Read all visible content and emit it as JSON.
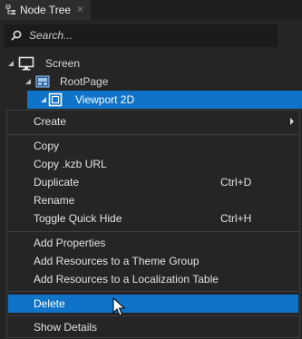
{
  "panel": {
    "tab_title": "Node Tree",
    "close_glyph": "×",
    "tab_icon": "node-tree-icon"
  },
  "search": {
    "placeholder": "Search...",
    "value": ""
  },
  "tree": {
    "items": [
      {
        "label": "Screen",
        "icon": "monitor-icon",
        "expanded": true
      },
      {
        "label": "RootPage",
        "icon": "page-icon",
        "expanded": true
      },
      {
        "label": "Viewport 2D",
        "icon": "viewport-icon",
        "expanded": true,
        "selected": true
      }
    ]
  },
  "context_menu": {
    "items": [
      {
        "label": "Create",
        "shortcut": "",
        "submenu": true
      },
      {
        "label": "Copy",
        "shortcut": ""
      },
      {
        "label": "Copy .kzb URL",
        "shortcut": ""
      },
      {
        "label": "Duplicate",
        "shortcut": "Ctrl+D"
      },
      {
        "label": "Rename",
        "shortcut": ""
      },
      {
        "label": "Toggle Quick Hide",
        "shortcut": "Ctrl+H"
      },
      {
        "label": "Add Properties",
        "shortcut": ""
      },
      {
        "label": "Add Resources to a Theme Group",
        "shortcut": ""
      },
      {
        "label": "Add Resources to a Localization Table",
        "shortcut": ""
      },
      {
        "label": "Delete",
        "shortcut": "",
        "highlighted": true
      },
      {
        "label": "Show Details",
        "shortcut": ""
      }
    ]
  },
  "colors": {
    "selection": "#0f73c8",
    "panel_bg": "#252526",
    "text": "#d8d8d8"
  }
}
